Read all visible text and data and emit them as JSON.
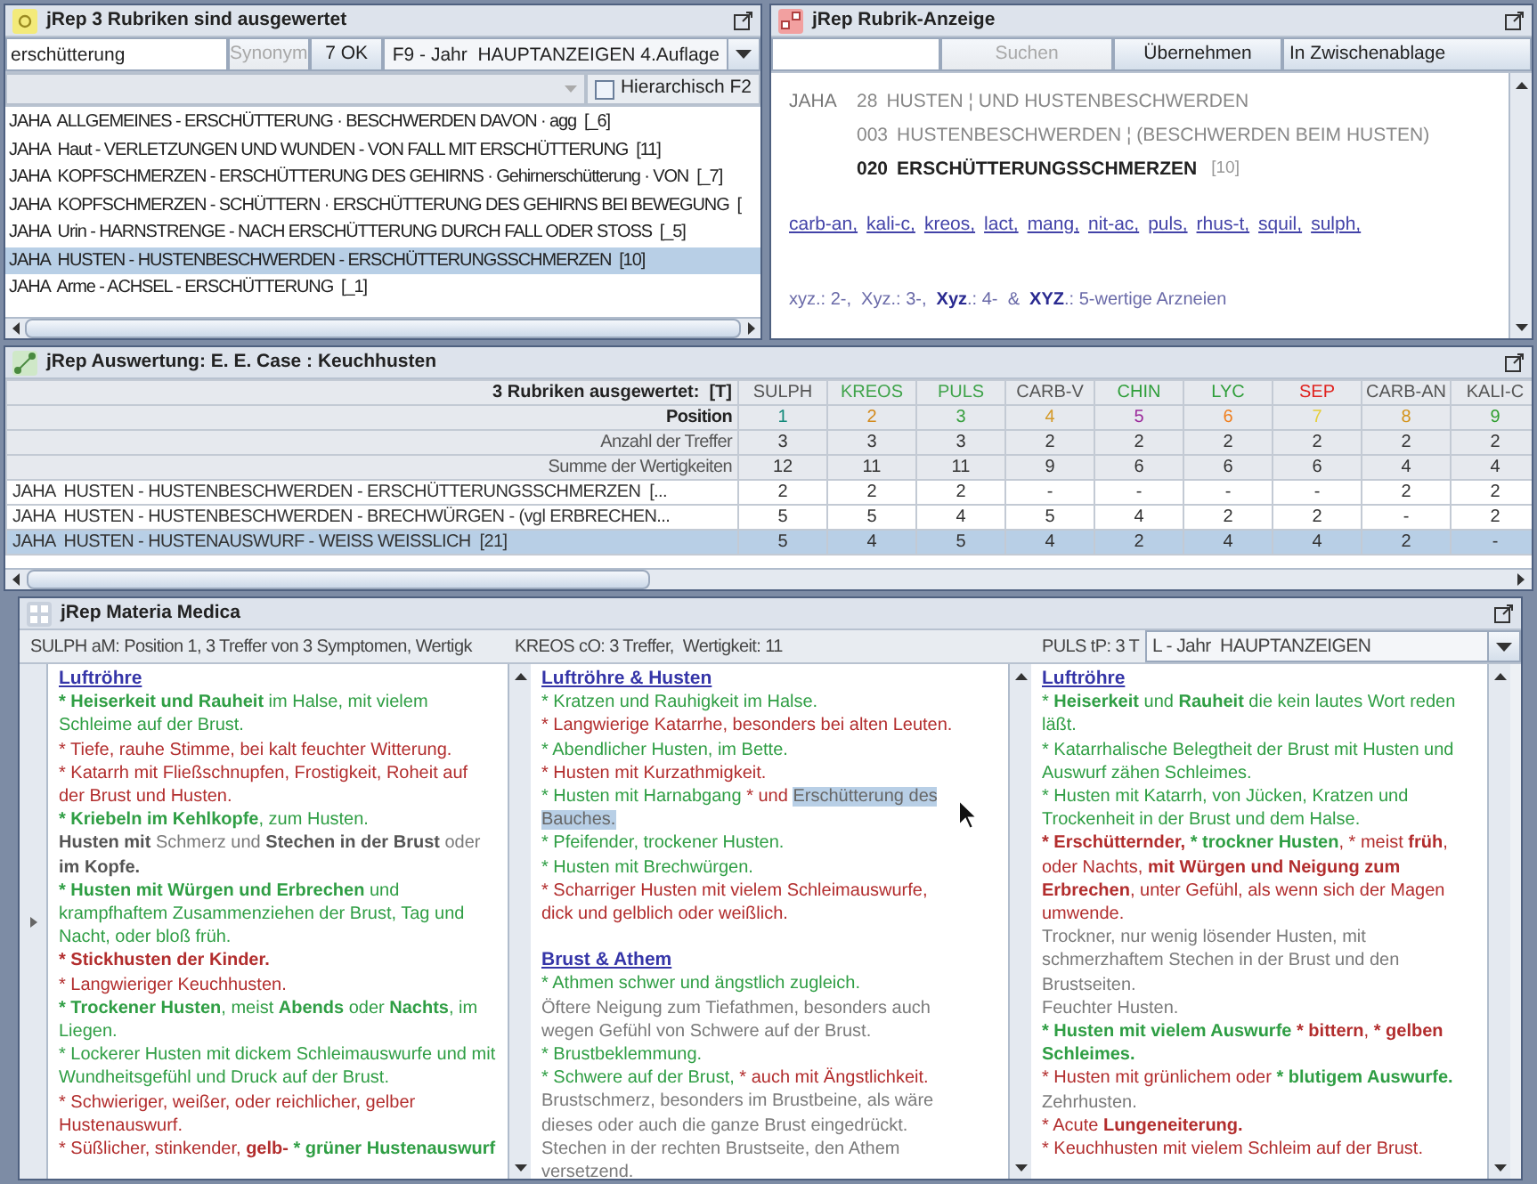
{
  "rubric_search": {
    "title": "jRep 3 Rubriken sind ausgewertet",
    "search_value": "erschütterung",
    "synonym_button": {
      "label": "Synonym",
      "disabled": true
    },
    "ok_button": {
      "label": "7 OK",
      "disabled": false
    },
    "repertory_select": "F9 - Jahr  HAUPTANZEIGEN 4.Auflage",
    "hierarchical_checkbox": {
      "label": "Hierarchisch F2",
      "checked": false
    },
    "results": [
      {
        "text": "JAHA  ALLGEMEINES - ERSCHÜTTERUNG · BESCHWERDEN DAVON · agg  [_6]",
        "selected": false
      },
      {
        "text": "JAHA  Haut - VERLETZUNGEN UND WUNDEN - VON FALL MIT ERSCHÜTTERUNG  [11]",
        "selected": false
      },
      {
        "text": "JAHA  KOPFSCHMERZEN - ERSCHÜTTERUNG DES GEHIRNS · Gehirnerschütterung · VON  [_7]",
        "selected": false
      },
      {
        "text": "JAHA  KOPFSCHMERZEN - SCHÜTTERN · ERSCHÜTTERUNG DES GEHIRNS BEI BEWEGUNG  [",
        "selected": false
      },
      {
        "text": "JAHA  Urin - HARNSTRENGE - NACH ERSCHÜTTERUNG DURCH FALL ODER STOSS  [_5]",
        "selected": false
      },
      {
        "text": "JAHA  HUSTEN - HUSTENBESCHWERDEN - ERSCHÜTTERUNGSSCHMERZEN  [10]",
        "selected": true
      },
      {
        "text": "JAHA  Arme - ACHSEL - ERSCHÜTTERUNG  [_1]",
        "selected": false
      }
    ]
  },
  "rubric_display": {
    "title": "jRep  Rubrik-Anzeige",
    "search_button": {
      "label": "Suchen",
      "disabled": true
    },
    "accept_button": {
      "label": "Übernehmen",
      "disabled": false
    },
    "clipboard_button": {
      "label": "In Zwischenablage",
      "disabled": false
    },
    "hierarchy": [
      {
        "source": "JAHA",
        "number": "28",
        "text": "HUSTEN ¦ UND HUSTENBESCHWERDEN",
        "current": false,
        "children": [
          {
            "number": "003",
            "text": "HUSTENBESCHWERDEN ¦ (BESCHWERDEN BEIM HUSTEN)",
            "current": false,
            "children": [
              {
                "number": "020",
                "text": "ERSCHÜTTERUNGSSCHMERZEN",
                "count": "[10]",
                "current": true
              }
            ]
          }
        ]
      }
    ],
    "remedies": [
      "carb-an,",
      "kali-c,",
      "kreos,",
      "lact,",
      "mang,",
      "nit-ac,",
      "puls,",
      "rhus-t,",
      "squil,",
      "sulph,"
    ],
    "legend": "xyz.: 2-,  Xyz.: 3-,  **Xyz**.: 4-  &  **XYZ**.: 5-wertige Arzneien"
  },
  "evaluation": {
    "title": "jRep Auswertung: E. E. Case : Keuchhusten",
    "header_label": "3 Rubriken ausgewertet:  [T]",
    "columns": [
      {
        "label": "SULPH",
        "color": "#555555"
      },
      {
        "label": "KREOS",
        "color": "#3fa34a"
      },
      {
        "label": "PULS",
        "color": "#3fa34a"
      },
      {
        "label": "CARB-V",
        "color": "#555555"
      },
      {
        "label": "CHIN",
        "color": "#2f9e3a"
      },
      {
        "label": "LYC",
        "color": "#2f9e3a"
      },
      {
        "label": "SEP",
        "color": "#e0231f"
      },
      {
        "label": "CARB-AN",
        "color": "#555555"
      },
      {
        "label": "KALI-C",
        "color": "#555555"
      }
    ],
    "rows": [
      {
        "kind": "position",
        "label": "Position",
        "cells": [
          {
            "text": "1",
            "color": "#12897a"
          },
          {
            "text": "2",
            "color": "#d38a1c"
          },
          {
            "text": "3",
            "color": "#3aa040"
          },
          {
            "text": "4",
            "color": "#d49a2a"
          },
          {
            "text": "5",
            "color": "#9b2a9b"
          },
          {
            "text": "6",
            "color": "#f07f1e"
          },
          {
            "text": "7",
            "color": "#e6cf3c"
          },
          {
            "text": "8",
            "color": "#d4941c"
          },
          {
            "text": "9",
            "color": "#2f9e2f"
          }
        ],
        "selected": false
      },
      {
        "kind": "summary",
        "label": "Anzahl der Treffer",
        "cells": [
          "3",
          "3",
          "3",
          "2",
          "2",
          "2",
          "2",
          "2",
          "2"
        ],
        "selected": false
      },
      {
        "kind": "summary",
        "label": "Summe der Wertigkeiten",
        "cells": [
          "12",
          "11",
          "11",
          "9",
          "6",
          "6",
          "6",
          "4",
          "4"
        ],
        "selected": false
      },
      {
        "kind": "rubric",
        "label": "JAHA  HUSTEN - HUSTENBESCHWERDEN - ERSCHÜTTERUNGSSCHMERZEN  [...",
        "cells": [
          "2",
          "2",
          "2",
          "-",
          "-",
          "-",
          "-",
          "2",
          "2"
        ],
        "selected": false
      },
      {
        "kind": "rubric",
        "label": "JAHA  HUSTEN - HUSTENBESCHWERDEN - BRECHWÜRGEN - (vgl ERBRECHEN...",
        "cells": [
          "5",
          "5",
          "4",
          "5",
          "4",
          "2",
          "2",
          "-",
          "2"
        ],
        "selected": false
      },
      {
        "kind": "rubric",
        "label": "JAHA  HUSTEN - HUSTENAUSWURF - WEISS WEISSLICH  [21]",
        "cells": [
          "5",
          "4",
          "5",
          "4",
          "2",
          "4",
          "4",
          "2",
          "-"
        ],
        "selected": true
      }
    ]
  },
  "materia_medica": {
    "title": "jRep  Materia Medica",
    "repertory_select": "L - Jahr  HAUPTANZEIGEN",
    "columns": [
      {
        "header": "SULPH aM: Position 1, 3 Treffer von 3 Symptomen, Wertigk",
        "sections": [
          {
            "heading": "Luftröhre",
            "entries": [
              [
                {
                  "text": "* Heiserkeit und Rauheit",
                  "color": "#2f9e44",
                  "bold": true
                },
                {
                  "text": " im Halse, mit vielem Schleime auf der Brust.",
                  "color": "#2f9e44",
                  "bold": false
                }
              ],
              [
                {
                  "text": "* Tiefe, rauhe Stimme, bei kalt feuchter Witterung.",
                  "color": "#b22d2d",
                  "bold": false
                }
              ],
              [
                {
                  "text": "* Katarrh mit Fließschnupfen, Frostigkeit, Roheit auf der Brust und Husten.",
                  "color": "#b22d2d",
                  "bold": false
                }
              ],
              [
                {
                  "text": "* Kriebeln im Kehlkopfe",
                  "color": "#2f9e44",
                  "bold": true
                },
                {
                  "text": ", zum Husten.",
                  "color": "#2f9e44",
                  "bold": false
                }
              ],
              [
                {
                  "text": "Husten mit",
                  "color": "#555555",
                  "bold": true
                },
                {
                  "text": " Schmerz und ",
                  "color": "#7a7a7a",
                  "bold": false
                },
                {
                  "text": "Stechen in der Brust",
                  "color": "#555555",
                  "bold": true
                },
                {
                  "text": " oder ",
                  "color": "#7a7a7a",
                  "bold": false
                },
                {
                  "text": "im Kopfe.",
                  "color": "#555555",
                  "bold": true
                }
              ],
              [
                {
                  "text": "* Husten mit Würgen und Erbrechen",
                  "color": "#2f9e44",
                  "bold": true
                },
                {
                  "text": " und krampfhaftem Zusammenziehen der Brust, Tag und Nacht, oder bloß früh.",
                  "color": "#2f9e44",
                  "bold": false
                }
              ],
              [
                {
                  "text": "* Stickhusten der Kinder.",
                  "color": "#b22d2d",
                  "bold": true
                }
              ],
              [
                {
                  "text": "* Langwieriger Keuchhusten.",
                  "color": "#b22d2d",
                  "bold": false
                }
              ],
              [
                {
                  "text": "* Trockener Husten",
                  "color": "#2f9e44",
                  "bold": true
                },
                {
                  "text": ", meist ",
                  "color": "#2f9e44",
                  "bold": false
                },
                {
                  "text": "Abends",
                  "color": "#2f9e44",
                  "bold": true
                },
                {
                  "text": " oder ",
                  "color": "#2f9e44",
                  "bold": false
                },
                {
                  "text": "Nachts",
                  "color": "#2f9e44",
                  "bold": true
                },
                {
                  "text": ", im Liegen.",
                  "color": "#2f9e44",
                  "bold": false
                }
              ],
              [
                {
                  "text": "* Lockerer Husten mit dickem Schleimauswurfe und mit Wundheitsgefühl und Druck auf der Brust.",
                  "color": "#2f9e44",
                  "bold": false
                }
              ],
              [
                {
                  "text": "* Schwieriger, weißer, oder reichlicher, gelber Hustenauswurf.",
                  "color": "#b22d2d",
                  "bold": false
                }
              ],
              [
                {
                  "text": "* Süßlicher, stinkender, ",
                  "color": "#b22d2d",
                  "bold": false
                },
                {
                  "text": "gelb-",
                  "color": "#b22d2d",
                  "bold": true
                },
                {
                  "text": " * grüner Hustenauswurf",
                  "color": "#2f9e44",
                  "bold": true
                }
              ]
            ]
          }
        ]
      },
      {
        "header": "KREOS cO: 3 Treffer,  Wertigkeit: 11",
        "sections": [
          {
            "heading": "Luftröhre & Husten",
            "entries": [
              [
                {
                  "text": "* Kratzen und Rauhigkeit im Halse.",
                  "color": "#2f9e44",
                  "bold": false
                }
              ],
              [
                {
                  "text": "* Langwierige Katarrhe, besonders bei alten Leuten.",
                  "color": "#b22d2d",
                  "bold": false
                }
              ],
              [
                {
                  "text": "* Abendlicher Husten, im Bette.",
                  "color": "#2f9e44",
                  "bold": false
                }
              ],
              [
                {
                  "text": "* Husten mit Kurzathmigkeit.",
                  "color": "#b22d2d",
                  "bold": false
                }
              ],
              [
                {
                  "text": "* Husten mit Harnabgang",
                  "color": "#2f9e44",
                  "bold": false,
                  "highlighted": false
                },
                {
                  "text": " * und ",
                  "color": "#b22d2d",
                  "bold": false,
                  "highlighted": false
                },
                {
                  "text": "Erschütterung des Bauches.",
                  "color": "#666666",
                  "bold": false,
                  "highlighted": true
                }
              ],
              [
                {
                  "text": "* Pfeifender, trockener Husten.",
                  "color": "#2f9e44",
                  "bold": false
                }
              ],
              [
                {
                  "text": "* Husten mit Brechwürgen.",
                  "color": "#2f9e44",
                  "bold": false
                }
              ],
              [
                {
                  "text": "* Scharriger Husten mit vielem Schleimauswurfe, dick und gelblich oder weißlich.",
                  "color": "#b22d2d",
                  "bold": false
                }
              ]
            ]
          },
          {
            "heading": "Brust & Athem",
            "entries": [
              [
                {
                  "text": "* Athmen schwer und ängstlich zugleich.",
                  "color": "#2f9e44",
                  "bold": false
                }
              ],
              [
                {
                  "text": "Öftere Neigung zum Tiefathmen, besonders auch wegen Gefühl von Schwere auf der Brust.",
                  "color": "#7a7a7a",
                  "bold": false
                }
              ],
              [
                {
                  "text": "* Brustbeklemmung.",
                  "color": "#2f9e44",
                  "bold": false
                }
              ],
              [
                {
                  "text": "* Schwere auf der Brust,",
                  "color": "#2f9e44",
                  "bold": false
                },
                {
                  "text": " * auch mit Ängstlichkeit.",
                  "color": "#b22d2d",
                  "bold": false
                }
              ],
              [
                {
                  "text": "Brustschmerz, besonders im Brustbeine, als wäre dieses oder auch die ganze Brust eingedrückt.",
                  "color": "#7a7a7a",
                  "bold": false
                }
              ],
              [
                {
                  "text": "Stechen in der rechten Brustseite, den Athem versetzend.",
                  "color": "#7a7a7a",
                  "bold": false
                }
              ]
            ]
          }
        ]
      },
      {
        "header": "PULS tP: 3 T",
        "sections": [
          {
            "heading": "Luftröhre",
            "entries": [
              [
                {
                  "text": "* ",
                  "color": "#2f9e44",
                  "bold": false
                },
                {
                  "text": "Heiserkeit",
                  "color": "#2f9e44",
                  "bold": true
                },
                {
                  "text": " und ",
                  "color": "#2f9e44",
                  "bold": false
                },
                {
                  "text": "Rauheit",
                  "color": "#2f9e44",
                  "bold": true
                },
                {
                  "text": " die kein lautes Wort reden läßt.",
                  "color": "#2f9e44",
                  "bold": false
                }
              ],
              [
                {
                  "text": "* Katarrhalische Belegtheit der Brust mit Husten und Auswurf zähen Schleimes.",
                  "color": "#2f9e44",
                  "bold": false
                }
              ],
              [
                {
                  "text": "* Husten mit Katarrh, von Jücken, Kratzen und Trockenheit in der Brust und dem Halse.",
                  "color": "#2f9e44",
                  "bold": false
                }
              ],
              [
                {
                  "text": "* Erschütternder,",
                  "color": "#b22d2d",
                  "bold": true
                },
                {
                  "text": " * trockner Husten",
                  "color": "#2f9e44",
                  "bold": true
                },
                {
                  "text": ", * meist ",
                  "color": "#b22d2d",
                  "bold": false
                },
                {
                  "text": "früh",
                  "color": "#b22d2d",
                  "bold": true
                },
                {
                  "text": ", oder Nachts, ",
                  "color": "#b22d2d",
                  "bold": false
                },
                {
                  "text": "mit Würgen und Neigung zum Erbrechen",
                  "color": "#b22d2d",
                  "bold": true
                },
                {
                  "text": ", unter Gefühl, als wenn sich der Magen umwende.",
                  "color": "#b22d2d",
                  "bold": false
                }
              ],
              [
                {
                  "text": "Trockner, nur wenig lösender Husten, mit schmerzhaftem Stechen in der Brust und den Brustseiten.",
                  "color": "#7a7a7a",
                  "bold": false
                }
              ],
              [
                {
                  "text": "Feuchter Husten.",
                  "color": "#7a7a7a",
                  "bold": false
                }
              ],
              [
                {
                  "text": "* Husten mit vielem Auswurfe",
                  "color": "#2f9e44",
                  "bold": true
                },
                {
                  "text": " * bittern",
                  "color": "#b22d2d",
                  "bold": true
                },
                {
                  "text": ", ",
                  "color": "#b22d2d",
                  "bold": false
                },
                {
                  "text": "* gelben ",
                  "color": "#b22d2d",
                  "bold": true
                },
                {
                  "text": "Schleimes.",
                  "color": "#2f9e44",
                  "bold": true
                }
              ],
              [
                {
                  "text": "* Husten mit grünlichem oder ",
                  "color": "#b22d2d",
                  "bold": false
                },
                {
                  "text": "* blutigem Auswurfe.",
                  "color": "#2f9e44",
                  "bold": true
                }
              ],
              [
                {
                  "text": "Zehrhusten.",
                  "color": "#7a7a7a",
                  "bold": false
                }
              ],
              [
                {
                  "text": "* Acute ",
                  "color": "#b22d2d",
                  "bold": false
                },
                {
                  "text": "Lungeneiterung.",
                  "color": "#b22d2d",
                  "bold": true
                }
              ],
              [
                {
                  "text": "* Keuchhusten mit vielem Schleim auf der Brust.",
                  "color": "#b22d2d",
                  "bold": false
                }
              ]
            ]
          }
        ]
      }
    ]
  }
}
